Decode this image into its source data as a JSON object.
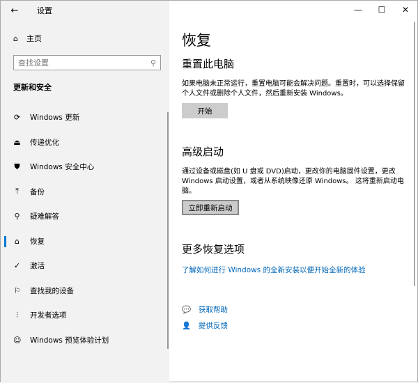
{
  "window": {
    "title": "设置",
    "controls": {
      "minimize": "—",
      "maximize": "☐",
      "close": "✕"
    },
    "back": "←"
  },
  "sidebar": {
    "home": "主页",
    "search_placeholder": "查找设置",
    "section": "更新和安全",
    "items": [
      {
        "label": "Windows 更新",
        "icon": "⟳"
      },
      {
        "label": "传递优化",
        "icon": "⏏"
      },
      {
        "label": "Windows 安全中心",
        "icon": "⛊"
      },
      {
        "label": "备份",
        "icon": "⤒"
      },
      {
        "label": "疑难解答",
        "icon": "⚲"
      },
      {
        "label": "恢复",
        "icon": "⌂"
      },
      {
        "label": "激活",
        "icon": "✓"
      },
      {
        "label": "查找我的设备",
        "icon": "⚐"
      },
      {
        "label": "开发者选项",
        "icon": "⫶"
      },
      {
        "label": "Windows 预览体验计划",
        "icon": "☺"
      }
    ]
  },
  "main": {
    "title": "恢复",
    "reset": {
      "heading": "重置此电脑",
      "desc": "如果电脑未正常运行，重置电脑可能会解决问题。重置时，可以选择保留个人文件或删除个人文件，然后重新安装 Windows。",
      "button": "开始"
    },
    "advanced": {
      "heading": "高级启动",
      "desc": "通过设备或磁盘(如 U 盘或 DVD)启动，更改你的电脑固件设置，更改 Windows 启动设置，或者从系统映像还原 Windows。 这将重新启动电脑。",
      "button": "立即重新启动"
    },
    "more": {
      "heading": "更多恢复选项",
      "link": "了解如何进行 Windows 的全新安装以便开始全新的体验"
    },
    "help": "获取帮助",
    "feedback": "提供反馈"
  }
}
